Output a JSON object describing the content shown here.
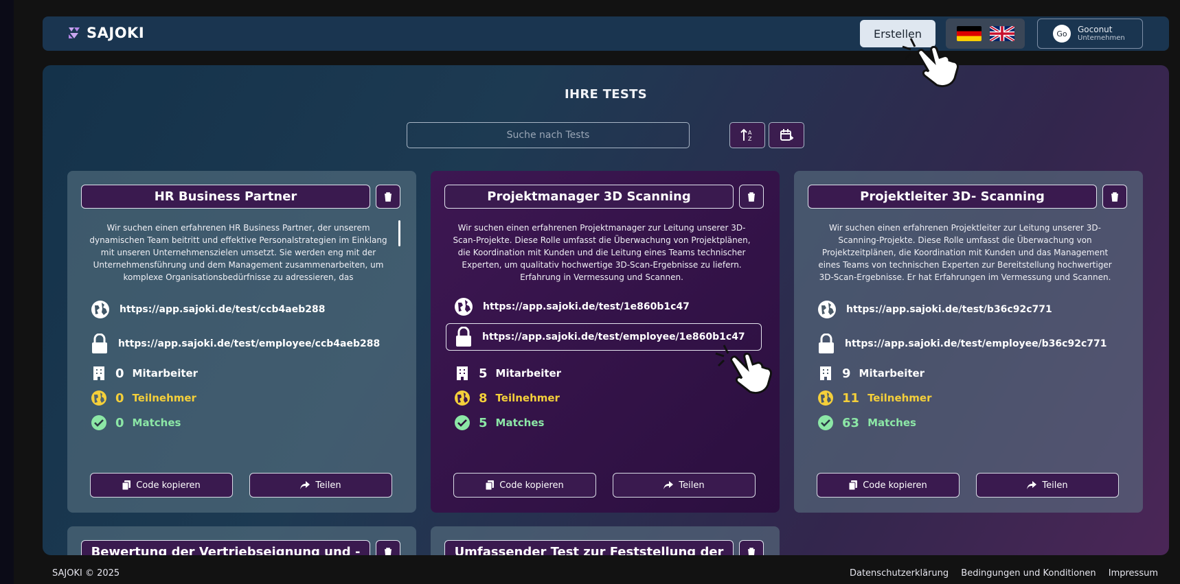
{
  "app": {
    "name": "SAJOKI"
  },
  "header": {
    "create_label": "Erstellen",
    "languages": [
      "de-flag-icon",
      "uk-flag-icon"
    ],
    "user": {
      "initials": "Go",
      "name": "Goconut",
      "role": "Unternehmen"
    }
  },
  "main": {
    "title": "IHRE TESTS",
    "search_placeholder": "Suche nach Tests"
  },
  "cards": [
    {
      "title": "HR Business Partner",
      "description": "Wir suchen einen erfahrenen HR Business Partner, der unserem dynamischen Team beitritt und effektive Personalstrategien im Einklang mit unseren Unternehmenszielen umsetzt. Sie werden eng mit der Unternehmensführung und dem Management zusammenarbeiten, um komplexe Organisationsbedürfnisse zu adressieren, das",
      "public_link": "https://app.sajoki.de/test/ccb4aeb288",
      "employee_link": "https://app.sajoki.de/test/employee/ccb4aeb288",
      "employees": "0",
      "employees_label": "Mitarbeiter",
      "participants": "0",
      "participants_label": "Teilnehmer",
      "matches": "0",
      "matches_label": "Matches",
      "copy_label": "Code kopieren",
      "share_label": "Teilen"
    },
    {
      "title": "Projektmanager 3D Scanning",
      "description": "Wir suchen einen erfahrenen Projektmanager zur Leitung unserer 3D-Scan-Projekte. Diese Rolle umfasst die Überwachung von Projektplänen, die Koordination mit Kunden und die Leitung eines Teams technischer Experten, um qualitativ hochwertige 3D-Scan-Ergebnisse zu liefern. Erfahrung in Vermessung und Scannen.",
      "public_link": "https://app.sajoki.de/test/1e860b1c47",
      "employee_link": "https://app.sajoki.de/test/employee/1e860b1c47",
      "employees": "5",
      "employees_label": "Mitarbeiter",
      "participants": "8",
      "participants_label": "Teilnehmer",
      "matches": "5",
      "matches_label": "Matches",
      "copy_label": "Code kopieren",
      "share_label": "Teilen"
    },
    {
      "title": "Projektleiter 3D- Scanning",
      "description": "Wir suchen einen erfahrenen Projektleiter zur Leitung unserer 3D-Scanning-Projekte. Diese Rolle umfasst die Überwachung von Projektzeitplänen, die Koordination mit Kunden und das Management eines Teams von technischen Experten zur Bereitstellung hochwertiger 3D-Scan-Ergebnisse. Er hat Erfahrungen im Vermessung und Scannen.",
      "public_link": "https://app.sajoki.de/test/b36c92c771",
      "employee_link": "https://app.sajoki.de/test/employee/b36c92c771",
      "employees": "9",
      "employees_label": "Mitarbeiter",
      "participants": "11",
      "participants_label": "Teilnehmer",
      "matches": "63",
      "matches_label": "Matches",
      "copy_label": "Code kopieren",
      "share_label": "Teilen"
    }
  ],
  "partial_cards": [
    {
      "title": "Bewertung der Vertriebseignung und -"
    },
    {
      "title": "Umfassender Test zur Feststellung der"
    }
  ],
  "footer": {
    "copyright": "SAJOKI © 2025",
    "links": [
      "Datenschutzerklärung",
      "Bedingungen und Konditionen",
      "Impressum"
    ]
  }
}
